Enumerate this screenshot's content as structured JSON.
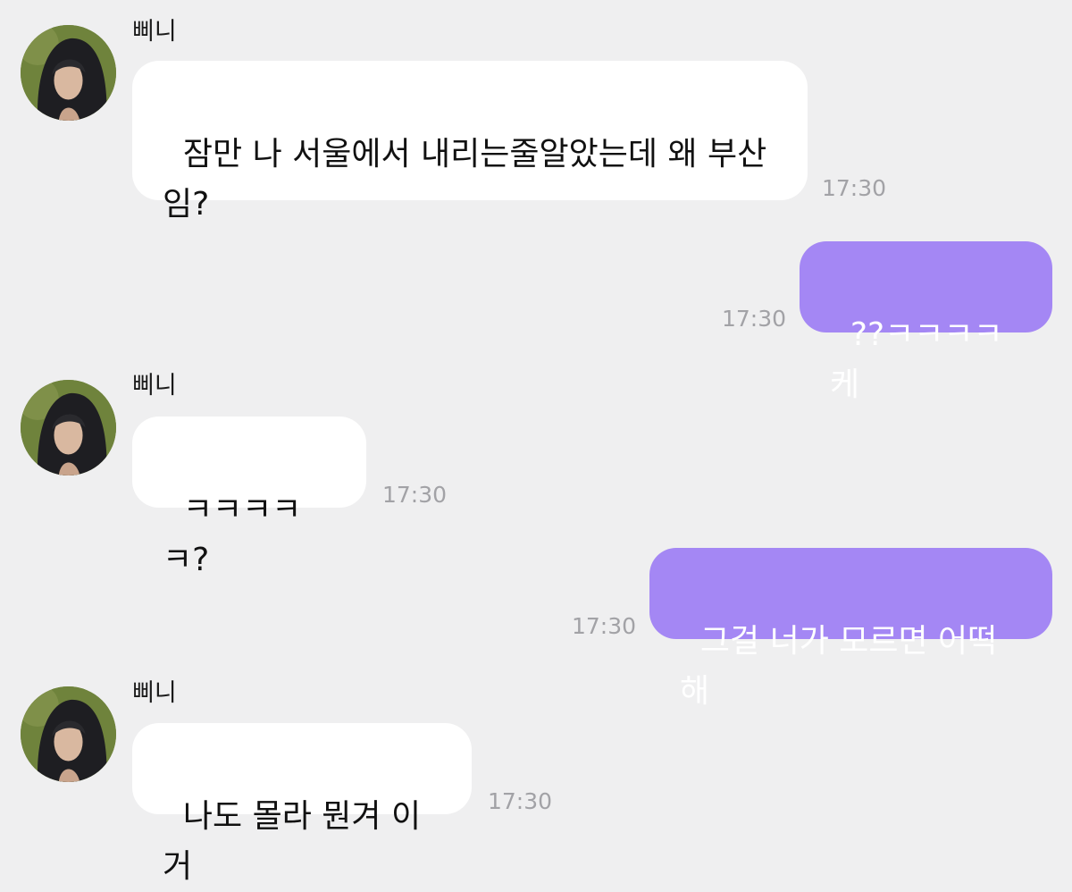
{
  "chat": {
    "contact_name": "삐니",
    "avatar_icon": "profile-photo-icon",
    "colors": {
      "background": "#efeff0",
      "incoming_bubble": "#ffffff",
      "outgoing_bubble": "#a487f4",
      "timestamp": "#a2a2a6"
    },
    "messages": [
      {
        "direction": "incoming",
        "sender": "삐니",
        "text": "잠만 나 서울에서 내리는줄알았는데 왜 부산\n임?",
        "time": "17:30"
      },
      {
        "direction": "outgoing",
        "text": "??ㅋㅋㅋㅋ케",
        "time": "17:30"
      },
      {
        "direction": "incoming",
        "sender": "삐니",
        "text": "ㅋㅋㅋㅋㅋ?",
        "time": "17:30"
      },
      {
        "direction": "outgoing",
        "text": "그걸 너가 모르면 어떡해",
        "time": "17:30"
      },
      {
        "direction": "incoming",
        "sender": "삐니",
        "text": "나도 몰라 뭔겨 이거",
        "time": "17:30"
      }
    ]
  }
}
